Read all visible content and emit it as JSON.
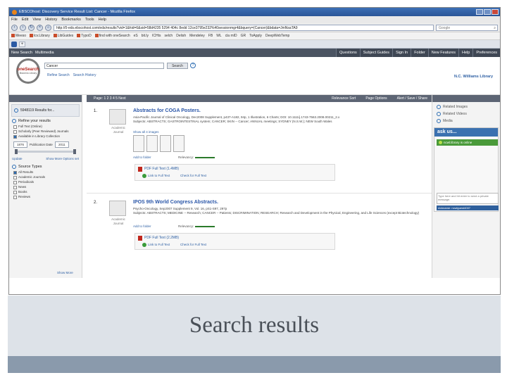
{
  "browser": {
    "title": "EBSCOhost: Discovery Service Result List: Cancer - Mozilla Firefox",
    "menu": [
      "File",
      "Edit",
      "View",
      "History",
      "Bookmarks",
      "Tools",
      "Help"
    ],
    "url": "http://0-eds.ebscohost.com/eds/results?vid=1&hid=6&sid=58d4235 5294 404c 8edd 12ce3795e232%40sessionmgr4&bquery=(Cancer)&bdata=JmNsaTA9",
    "search_placeholder": "Google",
    "bookmarks": [
      "Meeso",
      "tcv.Library",
      "LibGuides",
      "TypoD",
      "find with oneSearch",
      "eS",
      "bit.ly",
      "ICHts",
      "selch",
      "Delish",
      "Mendeley",
      "FB",
      "WL",
      "cla mID",
      "GR",
      "ToApply",
      "DeepWebTemp"
    ]
  },
  "ebsco_nav": {
    "left": [
      "New Search",
      "Multimedia"
    ],
    "right": [
      "Questions",
      "Subject Guides",
      "Sign In",
      "Folder",
      "New Features",
      "Help",
      "Preferences"
    ]
  },
  "search": {
    "logo_top": "oneSearch",
    "logo_bottom": "Bravens Library",
    "query": "Cancer",
    "button": "Search",
    "links": [
      "Refine Search",
      "Search History"
    ],
    "library": "N.C. Williams Library"
  },
  "left_panel": {
    "results_count": "5948119 Results for...",
    "refine_title": "Refine your results",
    "limiters": [
      {
        "label": "Full Text (Online)",
        "checked": false
      },
      {
        "label": "Scholarly (Peer Reviewed) Journals",
        "checked": false
      },
      {
        "label": "Available in Library Collection",
        "checked": true
      }
    ],
    "date_from": "1876",
    "date_label": "Publication Date",
    "date_to": "2011",
    "update": "Update",
    "show_more": "Show More Options set",
    "source_types_title": "Source Types",
    "source_types": [
      "All Results",
      "Academic Journals",
      "Periodicals",
      "News",
      "Books",
      "Reviews"
    ],
    "show_more_2": "Show More"
  },
  "results_bar": {
    "pages": "Page: 1 2 3 4 5 Next",
    "sort": "Relevance Sort",
    "page_options": "Page Options",
    "alert": "Alert / Save / Share"
  },
  "results": [
    {
      "num": "1.",
      "title": "Abstracts for COGA Posters.",
      "meta1": "Asia-Pacific Journal of Clinical Oncology, Dec2008 Supplement, p437-A182, 94p, 1 Illustration, 6 Charts; DOI: 10.1111/j.1743-7563.2008.00211_2.x",
      "meta2": "Subjects: ABSTRACTS; GASTROINTESTINAL system; CANCER; SKIN -- Cancer; ANNUAL meetings; SYDNEY (N.S.W.); NEW South Wales",
      "show_images": "Show all 4 images",
      "type": "Academic Journal",
      "add_folder": "Add to folder",
      "relevancy": "Relevancy:",
      "pdf": "PDF Full Text",
      "pdf_size": "(1.4MB)",
      "link": "Link to Full Text",
      "check": "Check for Full Text"
    },
    {
      "num": "2.",
      "title": "IPOS 9th World Congress Abstracts.",
      "meta1": "Psycho-Oncology, Sep2007 Supplement 9, Vol. 16, pS1-S97, 297p",
      "meta2": "Subjects: ABSTRACTS; MEDICINE -- Research; CANCER -- Patients; DISCRIMINATION; RESEARCH; Research and Development in the Physical, Engineering, and Life Sciences (except Biotechnology)",
      "type": "Academic Journal",
      "add_folder": "Add to folder",
      "relevancy": "Relevancy:",
      "pdf": "PDF Full Text",
      "pdf_size": "(2.2MB)",
      "link": "Link to Full Text",
      "check": "Check for Full Text"
    }
  ],
  "right_panel": {
    "related": [
      "Related Images",
      "Related Videos",
      "Media"
    ],
    "askus_title": "ask us...",
    "status": "ncwl.library is online",
    "msg_hint": "Type here and hit enter to send a private message.",
    "nick": "nickname: ncwlguest4007"
  },
  "caption": "Search results",
  "colors": {
    "caption_band": "#dde2e8",
    "footer_band": "#8a9aac",
    "ebsco_nav": "#4b5462",
    "link": "#2a56a8"
  }
}
